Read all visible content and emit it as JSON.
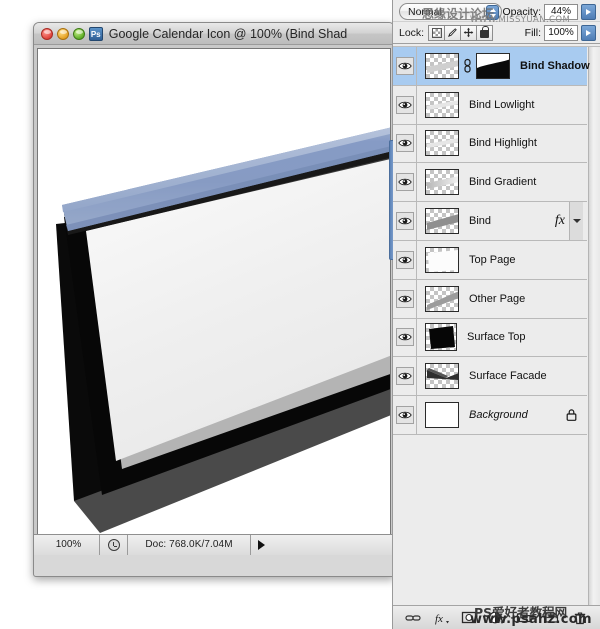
{
  "document_window": {
    "title": "Google Calendar Icon @ 100% (Bind Shad",
    "app_badge": "Ps",
    "traffic_lights": [
      "close",
      "minimize",
      "zoom"
    ],
    "status": {
      "zoom": "100%",
      "doc_info": "Doc: 768.0K/7.04M",
      "arrow": "expand-arrow"
    }
  },
  "layers_panel": {
    "blend_mode": "Normal",
    "opacity_label": "Opacity:",
    "opacity_value": "44%",
    "lock_label": "Lock:",
    "lock_buttons": [
      "lock-transparent-pixels",
      "lock-image-pixels",
      "lock-position",
      "lock-all"
    ],
    "fill_label": "Fill:",
    "fill_value": "100%",
    "layers": [
      {
        "name": "Bind Shadow",
        "selected": true,
        "has_mask": true,
        "has_link": true,
        "fx": false,
        "locked": false,
        "italic": false,
        "thumb": "bind-strip"
      },
      {
        "name": "Bind Lowlight",
        "selected": false,
        "has_mask": false,
        "has_link": false,
        "fx": false,
        "locked": false,
        "italic": false,
        "thumb": "bind-strip-light"
      },
      {
        "name": "Bind Highlight",
        "selected": false,
        "has_mask": false,
        "has_link": false,
        "fx": false,
        "locked": false,
        "italic": false,
        "thumb": "bind-strip-light"
      },
      {
        "name": "Bind Gradient",
        "selected": false,
        "has_mask": false,
        "has_link": false,
        "fx": false,
        "locked": false,
        "italic": false,
        "thumb": "bind-gradient"
      },
      {
        "name": "Bind",
        "selected": false,
        "has_mask": false,
        "has_link": false,
        "fx": true,
        "locked": false,
        "italic": false,
        "thumb": "bind-solid"
      },
      {
        "name": "Top Page",
        "selected": false,
        "has_mask": false,
        "has_link": false,
        "fx": false,
        "locked": false,
        "italic": false,
        "thumb": "page-white"
      },
      {
        "name": "Other Page",
        "selected": false,
        "has_mask": false,
        "has_link": false,
        "fx": false,
        "locked": false,
        "italic": false,
        "thumb": "page-diag"
      },
      {
        "name": "Surface Top",
        "selected": false,
        "has_mask": false,
        "has_link": false,
        "fx": false,
        "locked": false,
        "italic": false,
        "thumb": "surface-black"
      },
      {
        "name": "Surface Facade",
        "selected": false,
        "has_mask": false,
        "has_link": false,
        "fx": false,
        "locked": false,
        "italic": false,
        "thumb": "facade-diag"
      },
      {
        "name": "Background",
        "selected": false,
        "has_mask": false,
        "has_link": false,
        "fx": false,
        "locked": true,
        "italic": true,
        "thumb": "plain-white"
      }
    ],
    "bottom_buttons": [
      "link-layers-icon",
      "add-layer-style-icon",
      "add-layer-mask-icon",
      "new-adjustment-layer-icon",
      "new-group-icon",
      "new-layer-icon",
      "delete-layer-icon"
    ]
  },
  "watermarks": {
    "top_cn": "思缘设计论坛",
    "top_en": "WWW.MISSYUAN.COM",
    "bottom_cn": "PS爱好者教程网",
    "bottom_en": "www.psahz.com"
  },
  "colors": {
    "selection_blue": "#a8cbf0",
    "panel_bg": "#ececec",
    "bind_blue": "#7d92bd",
    "canvas_white": "#ffffff"
  }
}
